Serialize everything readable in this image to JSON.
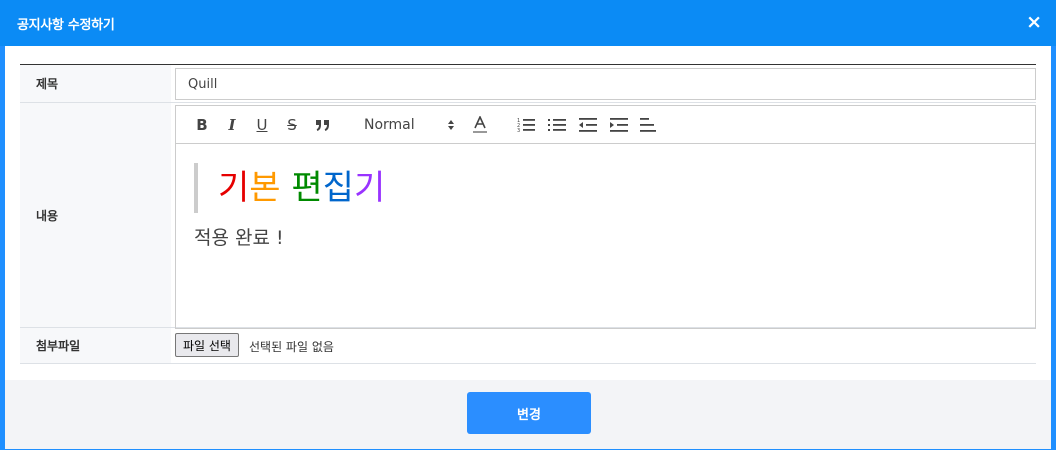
{
  "modal": {
    "title": "공지사항 수정하기",
    "close_label": "×"
  },
  "form": {
    "title_label": "제목",
    "title_value": "Quill",
    "content_label": "내용",
    "attachment_label": "첨부파일",
    "file_button_label": "파일 선택",
    "file_status": "선택된 파일 없음"
  },
  "toolbar": {
    "bold_label": "B",
    "italic_label": "I",
    "underline_label": "U",
    "strike_label": "S",
    "header_select_value": "Normal"
  },
  "editor_content": {
    "heading_chars": [
      {
        "char": "기",
        "color": "#e60000"
      },
      {
        "char": "본",
        "color": "#ff9900"
      },
      {
        "char": " ",
        "color": "#000000"
      },
      {
        "char": "편",
        "color": "#008a00"
      },
      {
        "char": "집",
        "color": "#0066cc"
      },
      {
        "char": "기",
        "color": "#9933ff"
      }
    ],
    "body_text": "적용 완료 !"
  },
  "footer": {
    "submit_label": "변경"
  },
  "colors": {
    "header_bg": "#0b8bf5",
    "button_bg": "#2b8eff"
  }
}
